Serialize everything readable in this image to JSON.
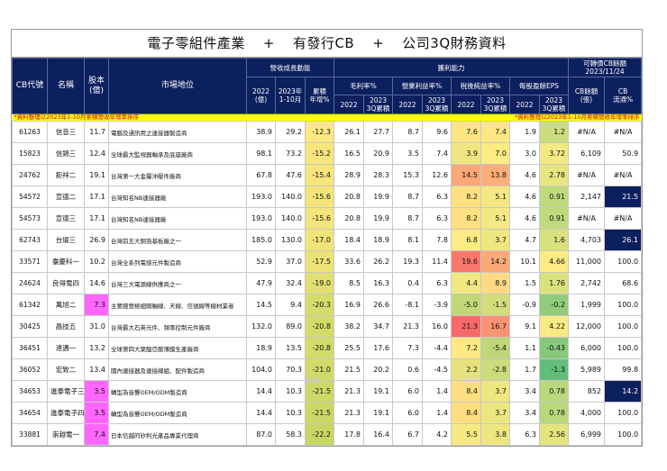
{
  "title": {
    "part1": "電子零組件產業",
    "plus": "+",
    "part2": "有發行CB",
    "part3": "公司3Q財務資料"
  },
  "headers": {
    "cb_code": "CB代號",
    "name": "名稱",
    "capital": "股本\n(億)",
    "market": "市場地位",
    "revenue_group": "營收成長動能",
    "rev_2022": "2022\n(億)",
    "rev_2023": "2023年\n1-10月",
    "rev_yoy": "累積\n年增%",
    "profit_group": "獲利能力",
    "gross": "毛利率%",
    "operating": "營業利益率%",
    "net": "稅後純益率%",
    "eps": "每股盈餘EPS",
    "y2022": "2022",
    "y2023": "2023\n3Q累積",
    "cb_group": "可轉債CB餘額\n2023/11/24",
    "cb_balance": "CB餘額\n(張)",
    "cb_float": "CB\n流通%"
  },
  "note_left": "*資料整理以2023年1-10月累積營收年增率排序",
  "note_right": "*資料整理以2023年1-10月累積營收年增率排序",
  "colors": {
    "header": "#0c1f5e",
    "note": "#ffff00",
    "pink": "#ff66ff",
    "navy": "#0c1f5e"
  },
  "rows": [
    [
      "61263",
      "信音三",
      "11.7",
      "電腦及通訊用之連接器製造商",
      "38.9",
      "29.2",
      "-12.3",
      "26.1",
      "27.7",
      "8.7",
      "9.6",
      "7.6",
      "7.4",
      "1.9",
      "1.2",
      "#N/A",
      "#N/A"
    ],
    [
      "15823",
      "信錦三",
      "12.4",
      "全球最大監視器軸承及底座廠商",
      "98.1",
      "73.2",
      "-15.2",
      "16.5",
      "20.9",
      "3.5",
      "7.4",
      "3.9",
      "7.0",
      "3.0",
      "3.72",
      "6,109",
      "50.9"
    ],
    [
      "24762",
      "鉅祥二",
      "19.1",
      "台灣第一大金屬沖壓件廠商",
      "67.8",
      "47.6",
      "-15.4",
      "28.9",
      "28.3",
      "15.3",
      "12.6",
      "14.5",
      "13.8",
      "4.6",
      "2.78",
      "#N/A",
      "#N/A"
    ],
    [
      "54572",
      "宣德二",
      "17.1",
      "台灣知名NB連接器廠",
      "193.0",
      "140.0",
      "-15.6",
      "20.8",
      "19.9",
      "8.7",
      "6.3",
      "8.2",
      "5.1",
      "4.6",
      "0.91",
      "2,147",
      "21.5"
    ],
    [
      "54573",
      "宣德三",
      "17.1",
      "台灣知名NB連接器廠",
      "193.0",
      "140.0",
      "-15.6",
      "20.8",
      "19.9",
      "8.7",
      "6.3",
      "8.2",
      "5.1",
      "4.6",
      "0.91",
      "#N/A",
      "#N/A"
    ],
    [
      "62743",
      "台燿三",
      "26.9",
      "台灣前五大銅箔基板廠之一",
      "185.0",
      "130.0",
      "-17.0",
      "18.4",
      "18.9",
      "8.1",
      "7.8",
      "6.8",
      "3.7",
      "4.7",
      "1.6",
      "4,703",
      "26.1"
    ],
    [
      "33571",
      "臺慶科一",
      "10.2",
      "台灣全系列電感元件製造商",
      "52.9",
      "37.0",
      "-17.5",
      "33.6",
      "26.2",
      "19.3",
      "11.4",
      "19.6",
      "14.2",
      "10.1",
      "4.66",
      "11,000",
      "100.0"
    ],
    [
      "24624",
      "良得電四",
      "14.6",
      "台灣三大電源線供應商之一",
      "47.9",
      "32.4",
      "-19.0",
      "8.5",
      "16.3",
      "0.4",
      "6.3",
      "4.4",
      "8.9",
      "1.5",
      "1.76",
      "2,742",
      "68.6"
    ],
    [
      "61342",
      "萬旭二",
      "7.3",
      "主要經營極細銅軸線、天線、信號線等線材業者",
      "14.5",
      "9.4",
      "-20.3",
      "16.9",
      "26.6",
      "-8.1",
      "-3.9",
      "-5.0",
      "-1.5",
      "-0.9",
      "-0.2",
      "1,999",
      "100.0"
    ],
    [
      "30425",
      "晶技五",
      "31.0",
      "台灣最大石英元件、頻率控制元件廠商",
      "132.0",
      "89.0",
      "-20.8",
      "38.2",
      "34.7",
      "21.3",
      "16.0",
      "21.3",
      "16.7",
      "9.1",
      "4.22",
      "12,000",
      "100.0"
    ],
    [
      "36451",
      "達邁一",
      "13.2",
      "全球第四大聚醯亞胺薄膜生產廠商",
      "18.9",
      "13.5",
      "-20.8",
      "25.5",
      "17.6",
      "7.3",
      "-4.4",
      "7.2",
      "-5.4",
      "1.1",
      "-0.43",
      "6,000",
      "100.0"
    ],
    [
      "36052",
      "宏致二",
      "13.4",
      "國內連接器及連接線組、配件製造商",
      "104.0",
      "70.3",
      "-21.0",
      "21.5",
      "20.2",
      "0.6",
      "-4.5",
      "2.2",
      "-2.8",
      "1.7",
      "-1.3",
      "5,989",
      "99.8"
    ],
    [
      "34653",
      "進泰電子三",
      "3.5",
      "轉型為音響OEM/ODM製造商",
      "14.4",
      "10.3",
      "-21.5",
      "21.3",
      "19.1",
      "6.0",
      "1.4",
      "8.4",
      "3.7",
      "3.4",
      "0.78",
      "852",
      "14.2"
    ],
    [
      "34654",
      "進泰電子四",
      "3.5",
      "轉型為音響OEM/ODM製造商",
      "14.4",
      "10.3",
      "-21.5",
      "21.3",
      "19.1",
      "6.0",
      "1.4",
      "8.4",
      "3.7",
      "3.4",
      "0.78",
      "4,000",
      "100.0"
    ],
    [
      "33881",
      "崇越電一",
      "7.4",
      "日本信越的矽利光產品專業代理商",
      "87.0",
      "58.3",
      "-22.2",
      "17.8",
      "16.4",
      "6.7",
      "4.2",
      "5.5",
      "3.8",
      "6.3",
      "2.56",
      "6,999",
      "100.0"
    ]
  ],
  "pink_rows": [
    "61342",
    "34653",
    "34654",
    "33881"
  ],
  "navy_float": [
    "54572",
    "62743",
    "34653"
  ]
}
